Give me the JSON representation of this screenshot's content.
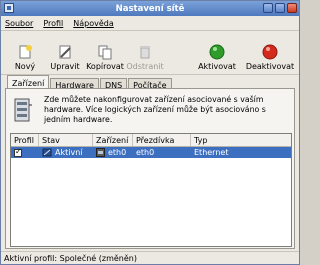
{
  "window": {
    "title": "Nastavení sítě"
  },
  "menu": {
    "file": "Soubor",
    "profile": "Profil",
    "help": "Nápověda"
  },
  "toolbar": {
    "new_label": "Nový",
    "edit_label": "Upravit",
    "copy_label": "Kopírovat",
    "delete_label": "Odstranit",
    "activate_label": "Aktivovat",
    "deactivate_label": "Deaktivovat"
  },
  "tabs": [
    {
      "label": "Zařízení"
    },
    {
      "label": "Hardware"
    },
    {
      "label": "DNS"
    },
    {
      "label": "Počítače"
    }
  ],
  "info": {
    "text": "Zde můžete nakonfigurovat zařízení asociované s vaším hardware. Více logických zařízení může být asociováno s jedním hardware."
  },
  "table": {
    "headers": [
      "Profil",
      "Stav",
      "Zařízení",
      "Přezdívka",
      "Typ"
    ],
    "rows": [
      {
        "profile_checked": true,
        "status": "Aktivní",
        "device": "eth0",
        "nickname": "eth0",
        "type": "Ethernet"
      }
    ]
  },
  "status": {
    "text": "Aktivní profil: Společné (změněn)"
  },
  "colors": {
    "title_bar": "#5a84c6",
    "selection": "#3d6fc0",
    "activate": "#2e9b2a",
    "deactivate": "#d42a1c"
  }
}
